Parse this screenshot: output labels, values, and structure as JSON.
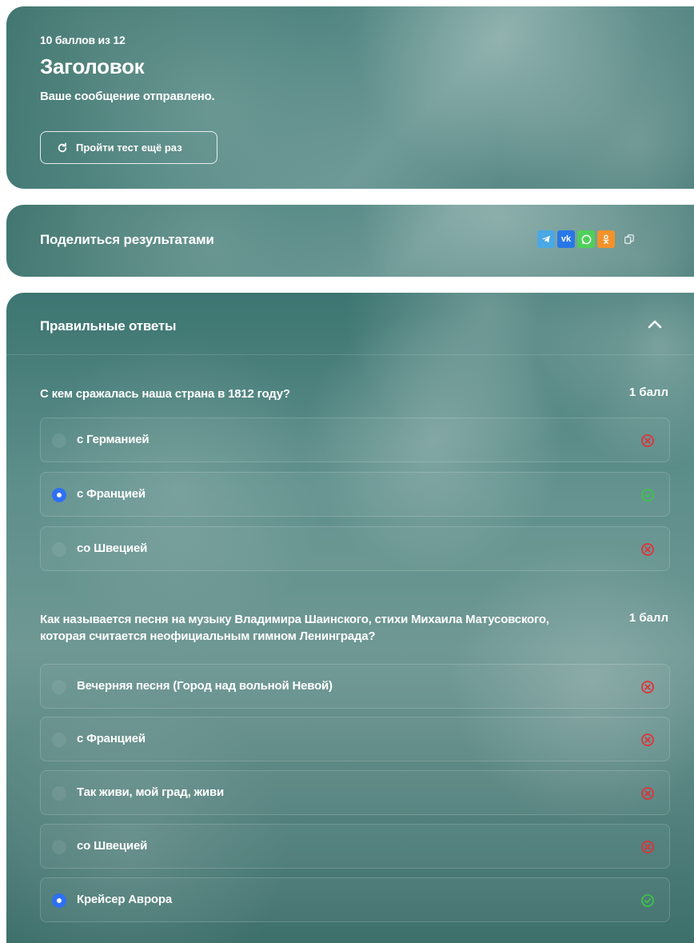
{
  "result": {
    "score": "10 баллов из 12",
    "title": "Заголовок",
    "message": "Ваше сообщение отправлено.",
    "retry_label": "Пройти тест ещё раз"
  },
  "share": {
    "title": "Поделиться результатами",
    "vk_label": "vk"
  },
  "answers": {
    "title": "Правильные ответы",
    "questions": [
      {
        "text": "С кем сражалась наша страна в 1812 году?",
        "points": "1 балл",
        "options": [
          {
            "label": "с Германией",
            "selected": false,
            "status": "wrong"
          },
          {
            "label": "с Францией",
            "selected": true,
            "status": "correct"
          },
          {
            "label": "со Швецией",
            "selected": false,
            "status": "wrong"
          }
        ]
      },
      {
        "text": "Как называется песня на музыку Владимира Шаинского, стихи Михаила Матусовского, которая считается неофициальным гимном Ленинграда?",
        "points": "1 балл",
        "options": [
          {
            "label": "Вечерняя песня (Город над вольной Невой)",
            "selected": false,
            "status": "wrong"
          },
          {
            "label": "с Францией",
            "selected": false,
            "status": "wrong"
          },
          {
            "label": "Так живи, мой град, живи",
            "selected": false,
            "status": "wrong"
          },
          {
            "label": "со Швецией",
            "selected": false,
            "status": "wrong"
          },
          {
            "label": "Крейсер Аврора",
            "selected": true,
            "status": "correct"
          }
        ]
      }
    ]
  },
  "colors": {
    "wrong": "#e0323a",
    "correct": "#3ec24a",
    "radio_selected": "#2f6ff3"
  },
  "icons": {
    "retry": "refresh-icon",
    "telegram": "telegram-icon",
    "vk": "vk-icon",
    "whatsapp": "whatsapp-icon",
    "ok": "odnoklassniki-icon",
    "copy": "copy-icon",
    "collapse": "chevron-up-icon",
    "wrong": "cross-circle-icon",
    "correct": "check-circle-icon"
  }
}
